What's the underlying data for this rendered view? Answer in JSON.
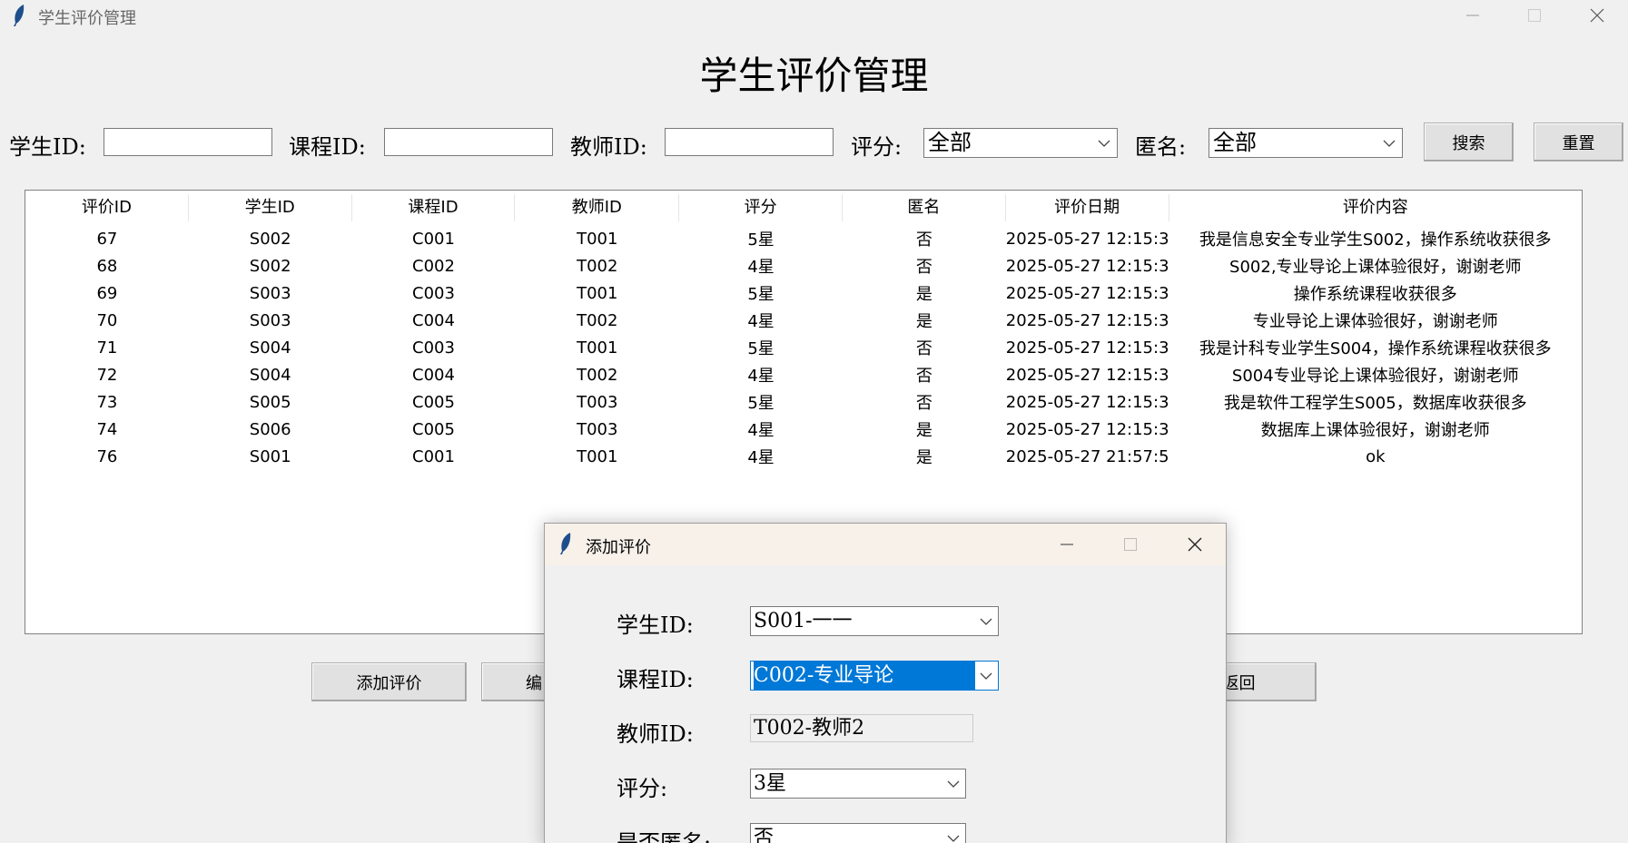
{
  "window": {
    "title": "学生评价管理"
  },
  "page_title": "学生评价管理",
  "search": {
    "student_label": "学生ID:",
    "course_label": "课程ID:",
    "teacher_label": "教师ID:",
    "rating_label": "评分:",
    "rating_value": "全部",
    "anon_label": "匿名:",
    "anon_value": "全部",
    "search_button": "搜索",
    "reset_button": "重置"
  },
  "table": {
    "columns": [
      "评价ID",
      "学生ID",
      "课程ID",
      "教师ID",
      "评分",
      "匿名",
      "评价日期",
      "评价内容"
    ],
    "rows": [
      [
        "67",
        "S002",
        "C001",
        "T001",
        "5星",
        "否",
        "2025-05-27 12:15:3",
        "我是信息安全专业学生S002，操作系统收获很多"
      ],
      [
        "68",
        "S002",
        "C002",
        "T002",
        "4星",
        "否",
        "2025-05-27 12:15:3",
        "S002,专业导论上课体验很好，谢谢老师"
      ],
      [
        "69",
        "S003",
        "C003",
        "T001",
        "5星",
        "是",
        "2025-05-27 12:15:3",
        "操作系统课程收获很多"
      ],
      [
        "70",
        "S003",
        "C004",
        "T002",
        "4星",
        "是",
        "2025-05-27 12:15:3",
        "专业导论上课体验很好，谢谢老师"
      ],
      [
        "71",
        "S004",
        "C003",
        "T001",
        "5星",
        "否",
        "2025-05-27 12:15:3",
        "我是计科专业学生S004，操作系统课程收获很多"
      ],
      [
        "72",
        "S004",
        "C004",
        "T002",
        "4星",
        "否",
        "2025-05-27 12:15:3",
        "S004专业导论上课体验很好，谢谢老师"
      ],
      [
        "73",
        "S005",
        "C005",
        "T003",
        "5星",
        "否",
        "2025-05-27 12:15:3",
        "我是软件工程学生S005，数据库收获很多"
      ],
      [
        "74",
        "S006",
        "C005",
        "T003",
        "4星",
        "是",
        "2025-05-27 12:15:3",
        "数据库上课体验很好，谢谢老师"
      ],
      [
        "76",
        "S001",
        "C001",
        "T001",
        "4星",
        "是",
        "2025-05-27 21:57:5",
        "ok"
      ]
    ]
  },
  "actions": {
    "add_button": "添加评价",
    "edit_button_partial": "编",
    "back_button_partial": "返回"
  },
  "dialog": {
    "title": "添加评价",
    "student_label": "学生ID:",
    "student_value": "S001-一一",
    "course_label": "课程ID:",
    "course_value": "C002-专业导论",
    "teacher_label": "教师ID:",
    "teacher_value": "T002-教师2",
    "rating_label": "评分:",
    "rating_value": "3星",
    "anon_label": "是否匿名:",
    "anon_value": "否"
  },
  "icons": {
    "app": "feather-icon",
    "minimize": "minimize-icon",
    "maximize": "maximize-icon",
    "close": "close-icon",
    "dropdown": "chevron-down-icon"
  },
  "colors": {
    "selection": "#0078d7",
    "background": "#f0f0f0",
    "dialog_title": "#f7f1ea"
  }
}
